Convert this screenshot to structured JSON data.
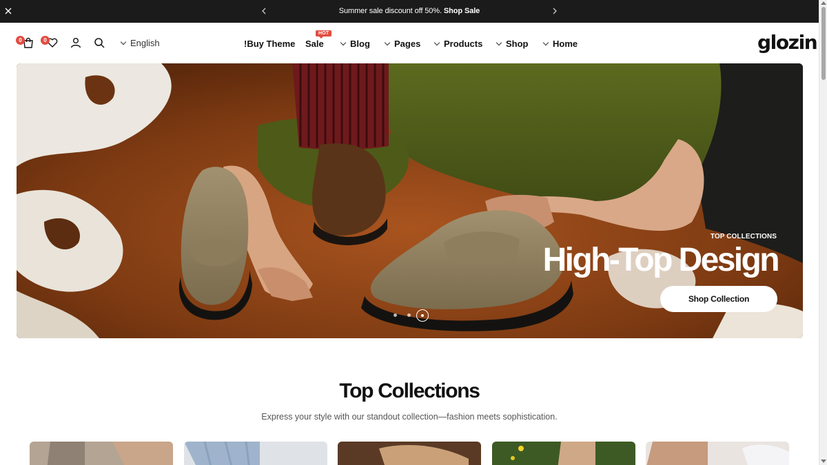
{
  "announcement": {
    "text": "Summer sale discount off 50%.",
    "link": "Shop Sale"
  },
  "header": {
    "cart_count": "0",
    "wishlist_count": "0",
    "language": "English",
    "hot_badge": "HOT",
    "nav": {
      "buy_theme": "!Buy Theme",
      "sale": "Sale",
      "blog": "Blog",
      "pages": "Pages",
      "products": "Products",
      "shop": "Shop",
      "home": "Home"
    },
    "logo": "glozin"
  },
  "hero": {
    "eyebrow": "TOP COLLECTIONS",
    "headline": "High-Top Design",
    "cta": "Shop Collection",
    "slide_index": 3,
    "slide_count": 3
  },
  "collections": {
    "title": "Top Collections",
    "subtitle": "Express your style with our standout collection—fashion meets sophistication."
  },
  "colors": {
    "topbar": "#1b1b1b",
    "badge": "#e24d42",
    "text": "#111111"
  }
}
